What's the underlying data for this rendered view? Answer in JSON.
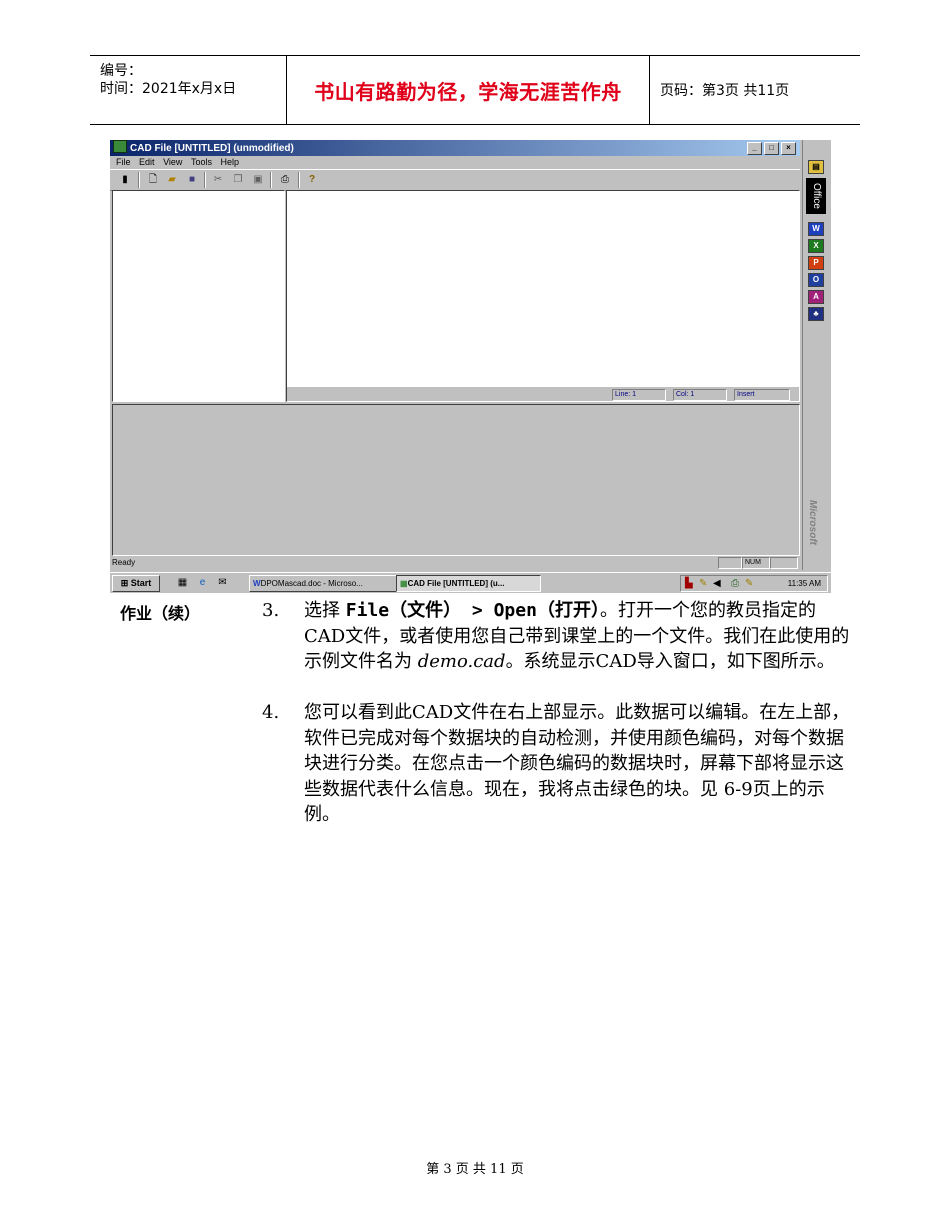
{
  "header": {
    "number_label": "编号：",
    "time_label": "时间：2021年x月x日",
    "motto": "书山有路勤为径，学海无涯苦作舟",
    "page_info": "页码：第3页  共11页"
  },
  "screenshot": {
    "window_title": "CAD File [UNTITLED] (unmodified)",
    "window_buttons": [
      "_",
      "□",
      "×"
    ],
    "menu": [
      "File",
      "Edit",
      "View",
      "Tools",
      "Help"
    ],
    "toolbar_icons": [
      "new-icon",
      "open-folder-icon",
      "save-icon",
      "cut-icon",
      "copy-icon",
      "paste-icon",
      "print-icon",
      "help-icon"
    ],
    "editor_status": {
      "line": "Line: 1",
      "col": "Col: 1",
      "mode": "Insert"
    },
    "status_ready": "Ready",
    "status_num": "NUM",
    "office_label": "Office",
    "microsoft_label": "Microsoft",
    "office_buttons": [
      {
        "name": "word-icon",
        "glyph": "W",
        "color": "#1f3fbf"
      },
      {
        "name": "excel-icon",
        "glyph": "X",
        "color": "#1e7a1e"
      },
      {
        "name": "powerpoint-icon",
        "glyph": "P",
        "color": "#d04010"
      },
      {
        "name": "outlook-icon",
        "glyph": "O",
        "color": "#2040a0"
      },
      {
        "name": "access-icon",
        "glyph": "A",
        "color": "#a0207a"
      },
      {
        "name": "team-icon",
        "glyph": "♣",
        "color": "#203080"
      }
    ],
    "taskbar": {
      "start": "Start",
      "tasks": [
        "DPOMascad.doc - Microso...",
        "CAD File [UNTITLED] (u..."
      ],
      "clock": "11:35 AM"
    }
  },
  "section_label": "作业（续）",
  "steps": [
    {
      "number": "3.",
      "pre": "选择 ",
      "code1": "File（文件） > Open（打开）",
      "mid": "。打开一个您的教员指定的CAD文件，或者使用您自己带到课堂上的一个文件。我们在此使用的示例文件名为 ",
      "filename": "demo.cad",
      "post": "。系统显示CAD导入窗口，如下图所示。"
    },
    {
      "number": "4.",
      "text": "您可以看到此CAD文件在右上部显示。此数据可以编辑。在左上部，软件已完成对每个数据块的自动检测，并使用颜色编码，对每个数据块进行分类。在您点击一个颜色编码的数据块时，屏幕下部将显示这些数据代表什么信息。现在，我将点击绿色的块。见 6-9页上的示例。"
    }
  ],
  "footer": "第 3 页 共 11 页"
}
